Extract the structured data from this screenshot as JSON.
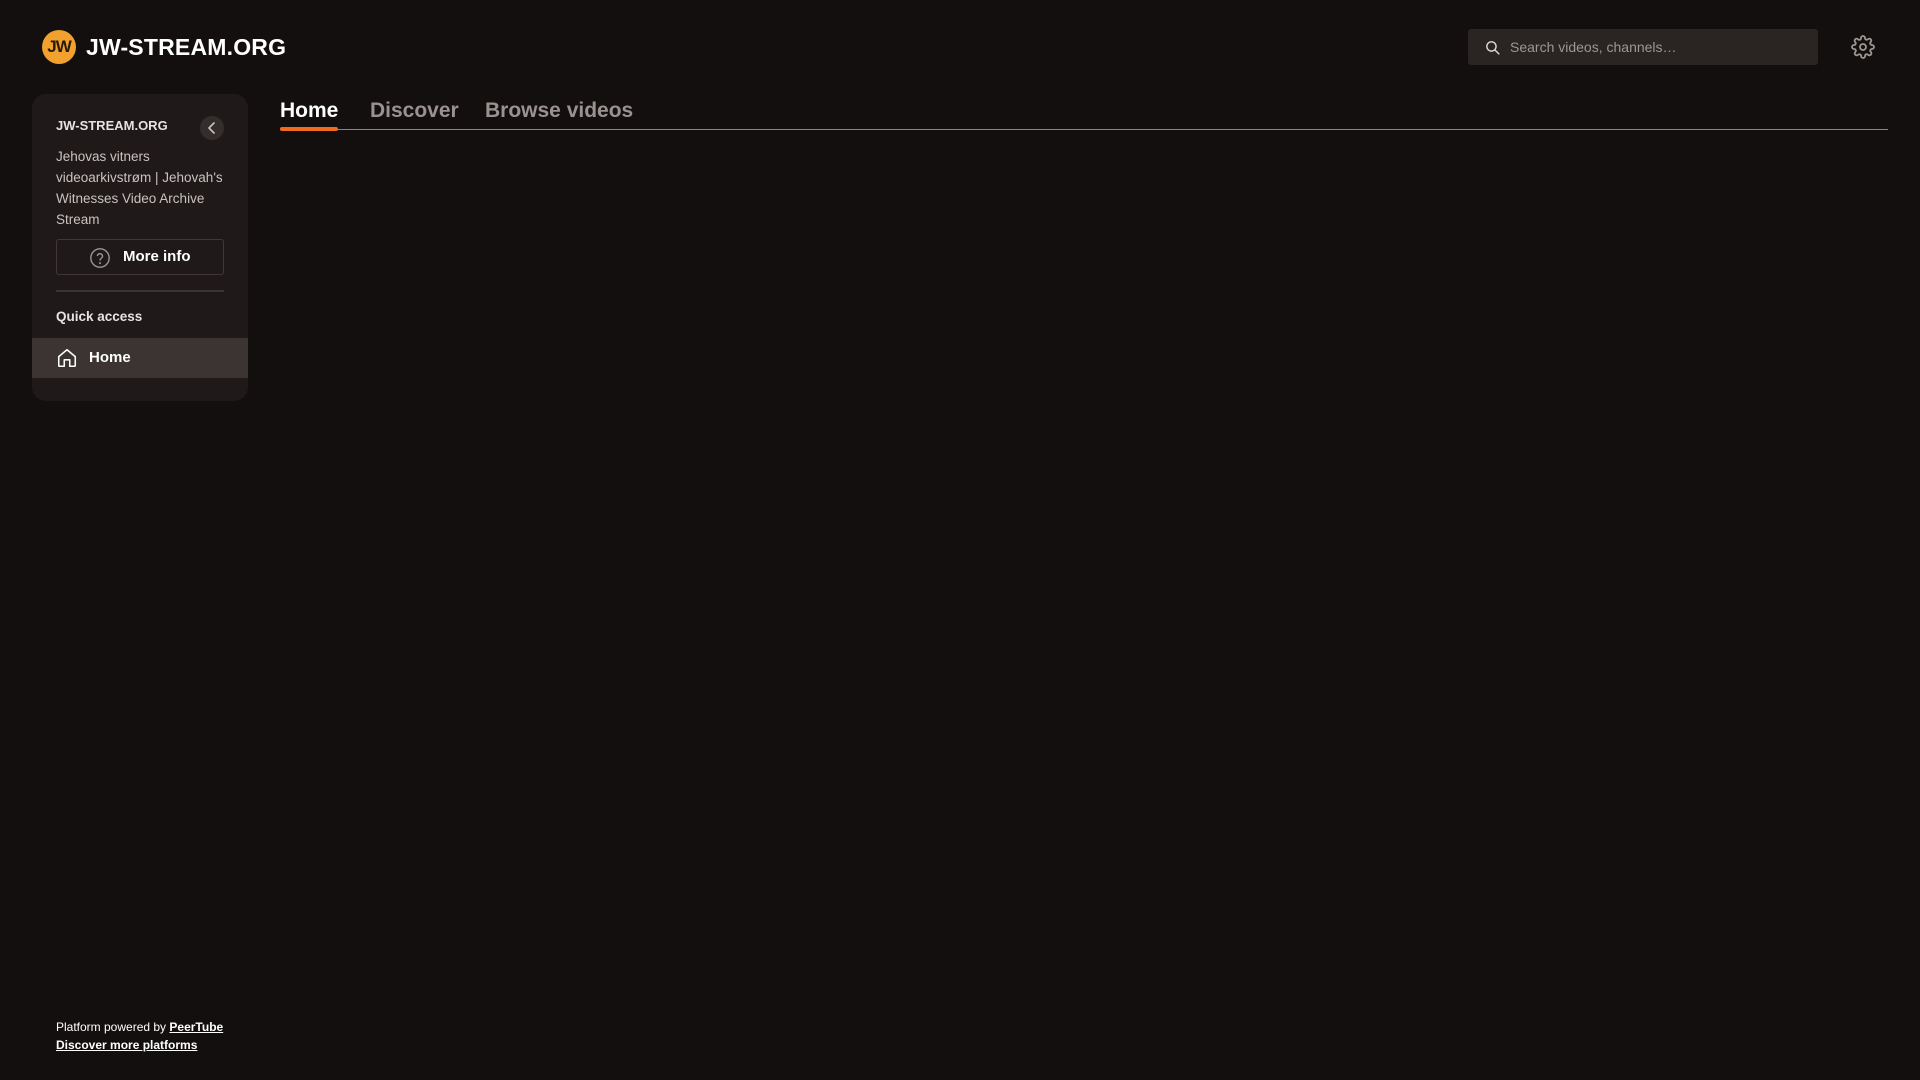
{
  "header": {
    "logo_text": "JW",
    "site_title": "JW-STREAM.ORG",
    "search_placeholder": "Search videos, channels…",
    "icons": {
      "search": "search-icon",
      "settings": "gear-icon"
    }
  },
  "sidebar": {
    "instance_name": "JW-STREAM.ORG",
    "description": "Jehovas vitners videoarkivstrøm | Jehovah's Witnesses Video Archive Stream",
    "more_info_label": "More info",
    "quick_access_label": "Quick access",
    "items": [
      {
        "label": "Home",
        "icon": "home-icon",
        "active": true
      }
    ]
  },
  "tabs": [
    {
      "label": "Home",
      "active": true
    },
    {
      "label": "Discover",
      "active": false
    },
    {
      "label": "Browse videos",
      "active": false
    }
  ],
  "footer": {
    "powered_by_prefix": "Platform powered by",
    "powered_by_link": "PeerTube",
    "discover_link": "Discover more platforms"
  },
  "colors": {
    "background": "#130f0e",
    "sidebar_bg": "#1f1a19",
    "accent": "#f06a1f",
    "logo": "#f2a12e"
  }
}
